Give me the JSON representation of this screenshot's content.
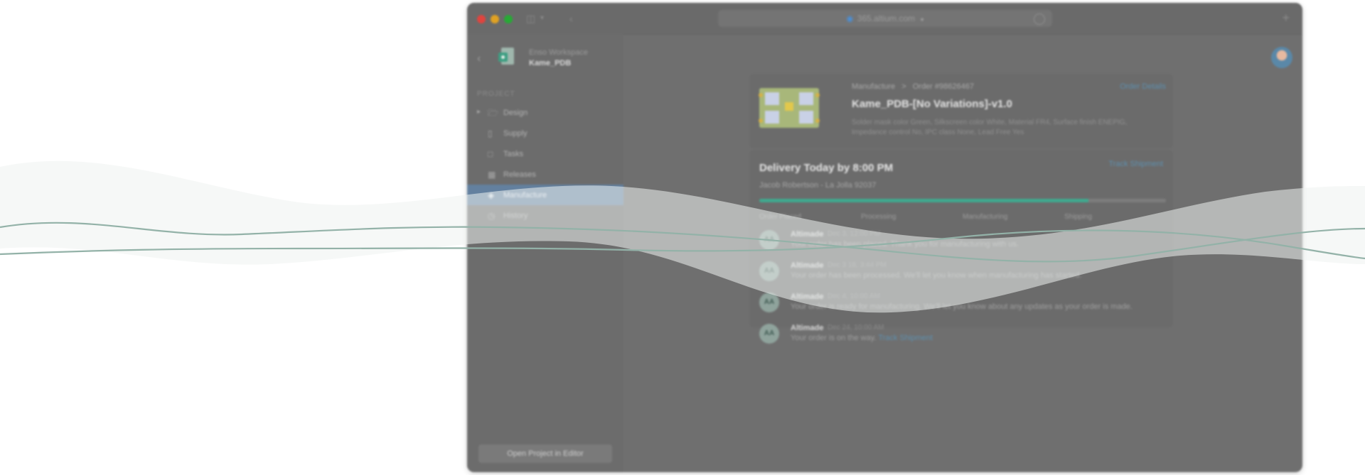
{
  "browser": {
    "address": "365.altium.com",
    "lock_icon": "lock-icon",
    "tab_icon": "plus-icon"
  },
  "sidebar": {
    "workspace_name": "Enso Workspace",
    "project_name": "Kame_PDB",
    "section_label": "PROJECT",
    "items": [
      {
        "label": "Design",
        "icon": "folder-icon",
        "expandable": true,
        "active": false
      },
      {
        "label": "Supply",
        "icon": "phone-icon",
        "active": false
      },
      {
        "label": "Tasks",
        "icon": "chat-icon",
        "active": false
      },
      {
        "label": "Releases",
        "icon": "grid-icon",
        "active": false
      },
      {
        "label": "Manufacture",
        "icon": "box-icon",
        "active": true
      },
      {
        "label": "History",
        "icon": "clock-icon",
        "active": false
      }
    ],
    "open_button": "Open Project in Editor"
  },
  "order": {
    "breadcrumb_section": "Manufacture",
    "breadcrumb_separator": ">",
    "breadcrumb_order": "Order #98626467",
    "details_link": "Order Details",
    "title": "Kame_PDB-[No Variations]-v1.0",
    "specs": "Solder mask color Green, Silkscreen color White, Material FR4, Surface finish ENEPIG, Impedance control No, IPC class None, Lead Free Yes"
  },
  "delivery": {
    "title": "Delivery Today by 8:00 PM",
    "track_link": "Track Shipment",
    "recipient": "Jacob Robertson - La Jolla 92037",
    "progress_fraction": 0.81,
    "steps": [
      "Order Placed",
      "Processing",
      "Manufacturing",
      "Shipping"
    ]
  },
  "messages": [
    {
      "sender": "Altimade",
      "time": "Dec 3, 12:00 PM",
      "text": "Your order has been placed. Thank you for manufacturing with us.",
      "link": ""
    },
    {
      "sender": "Altimade",
      "time": "Dec 3 18, 3:44 PM",
      "text": "Your order has been processed. We'll let you know when manufacturing has started.",
      "link": ""
    },
    {
      "sender": "Altimade",
      "time": "Dec 4, 10:00 AM",
      "text": "Your order is ready for manufacturing. We'll let you know about any updates as your order is made.",
      "link": ""
    },
    {
      "sender": "Altimade",
      "time": "Dec 24, 10:00 AM",
      "text": "Your order is on the way.",
      "link": "Track Shipment"
    }
  ],
  "avatar_initials": "AA",
  "colors": {
    "accent": "#63809f",
    "progress": "#3fa98f",
    "link": "#5e8fae",
    "wave_light": "#eef2f1",
    "wave_line": "#93b2a8"
  }
}
